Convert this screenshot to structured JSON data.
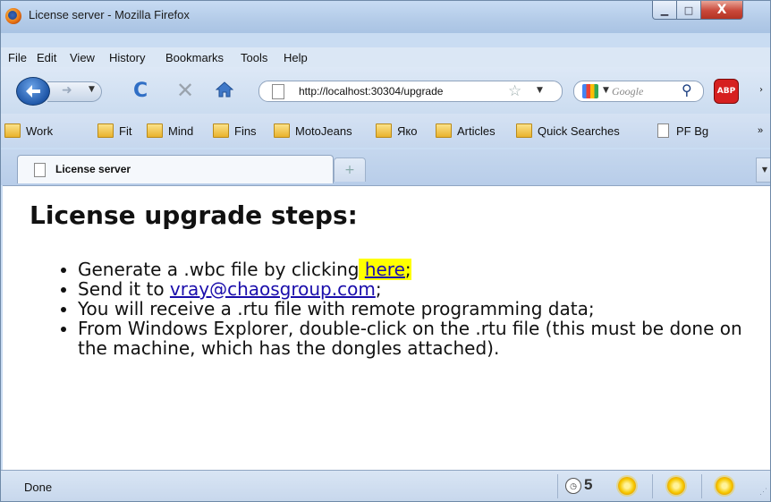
{
  "window": {
    "title": "License server - Mozilla Firefox",
    "minimize_glyph": "▁",
    "maximize_glyph": "□",
    "close_glyph": "X"
  },
  "menu": [
    "File",
    "Edit",
    "View",
    "History",
    "Bookmarks",
    "Tools",
    "Help"
  ],
  "nav": {
    "url": "http://localhost:30304/upgrade",
    "search_placeholder": "Google",
    "abp_label": "ABP",
    "more_glyph": "›"
  },
  "bookmarks": {
    "items": [
      {
        "label": "Work",
        "icon": "folder-icon"
      },
      {
        "label": "Fit",
        "icon": "folder-icon"
      },
      {
        "label": "Mind",
        "icon": "folder-icon"
      },
      {
        "label": "Fins",
        "icon": "folder-icon"
      },
      {
        "label": "MotoJeans",
        "icon": "folder-icon"
      },
      {
        "label": "Яко",
        "icon": "folder-icon"
      },
      {
        "label": "Articles",
        "icon": "folder-icon"
      },
      {
        "label": "Quick Searches",
        "icon": "folder-icon"
      },
      {
        "label": "PF Bg",
        "icon": "page-icon"
      }
    ],
    "more_glyph": "»"
  },
  "tabs": {
    "active_label": "License server",
    "new_tab_glyph": "+"
  },
  "page": {
    "heading": "License upgrade steps:",
    "steps": {
      "s1_text": "Generate a .wbc file by clicking",
      "s1_link": "here",
      "s1_after": ";",
      "s2_text": "Send it to",
      "s2_link": "vray@chaosgroup.com",
      "s2_after": ";",
      "s3_text": "You will receive a .rtu file with remote programming data;",
      "s4_text": "From Windows Explorer, double-click on the .rtu file (this must be done on the machine, which has the dongles attached)."
    }
  },
  "status": {
    "text": "Done",
    "count": "5"
  },
  "colors": {
    "highlight": "#ffff00",
    "link": "#1a0dab"
  }
}
